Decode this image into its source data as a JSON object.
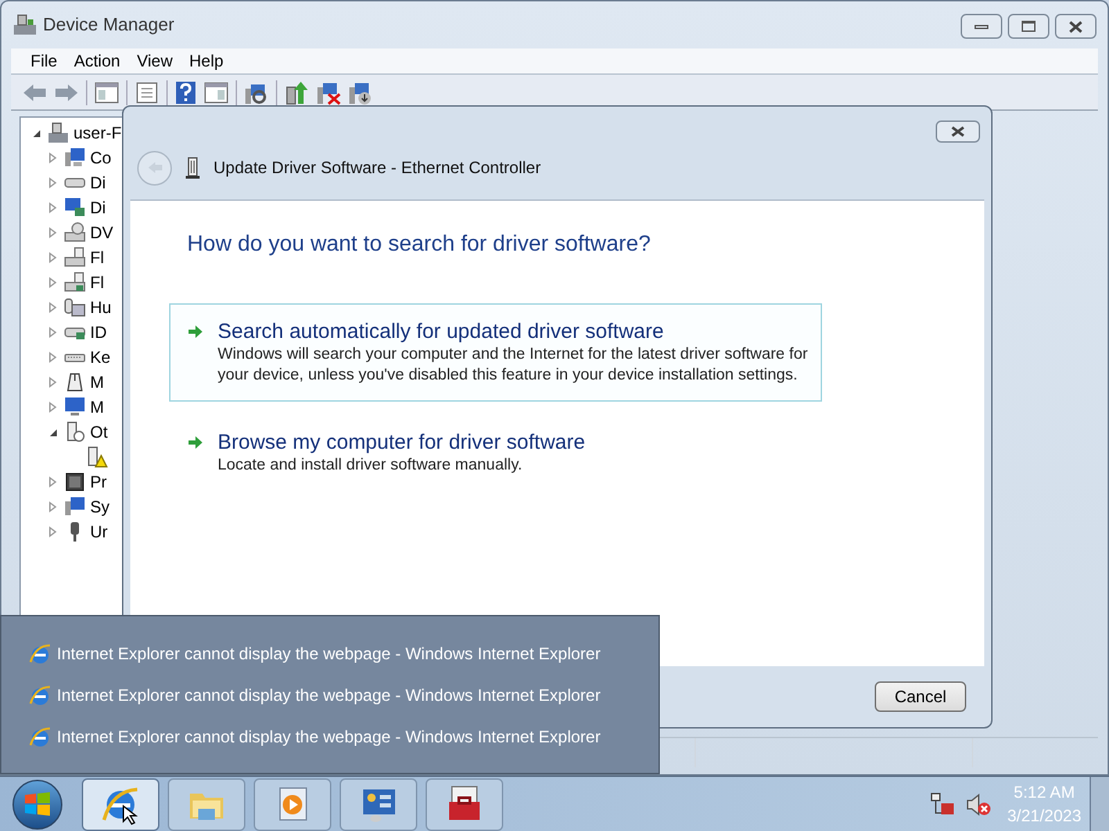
{
  "window": {
    "title": "Device Manager"
  },
  "menu": [
    "File",
    "Action",
    "View",
    "Help"
  ],
  "tree": {
    "label": "user-F",
    "expanded": true,
    "children": [
      {
        "label": "Co",
        "expanded": false
      },
      {
        "label": "Di",
        "expanded": false
      },
      {
        "label": "Di",
        "expanded": false
      },
      {
        "label": "DV",
        "expanded": false
      },
      {
        "label": "Fl",
        "expanded": false
      },
      {
        "label": "Fl",
        "expanded": false
      },
      {
        "label": "Hu",
        "expanded": false
      },
      {
        "label": "ID",
        "expanded": false
      },
      {
        "label": "Ke",
        "expanded": false
      },
      {
        "label": "M",
        "expanded": false
      },
      {
        "label": "M",
        "expanded": false
      },
      {
        "label": "Ot",
        "expanded": true,
        "children": [
          {
            "warning": true
          }
        ]
      },
      {
        "label": "Pr",
        "expanded": false
      },
      {
        "label": "Sy",
        "expanded": false
      },
      {
        "label": "Ur",
        "expanded": false
      }
    ]
  },
  "dialog": {
    "title": "Update Driver Software - Ethernet Controller",
    "back_disabled": true,
    "heading": "How do you want to search for driver software?",
    "options": [
      {
        "title": "Search automatically for updated driver software",
        "description": "Windows will search your computer and the Internet for the latest driver software for your device, unless you've disabled this feature in your device installation settings.",
        "selected": true
      },
      {
        "title": "Browse my computer for driver software",
        "description": "Locate and install driver software manually.",
        "selected": false
      }
    ],
    "cancel": "Cancel"
  },
  "taskbar_popup": [
    "Internet Explorer cannot display the webpage - Windows Internet Explorer",
    "Internet Explorer cannot display the webpage - Windows Internet Explorer",
    "Internet Explorer cannot display the webpage - Windows Internet Explorer"
  ],
  "taskbar": {
    "apps": [
      {
        "kind": "ie",
        "selected": true
      },
      {
        "kind": "folder",
        "selected": false
      },
      {
        "kind": "media",
        "selected": false
      },
      {
        "kind": "panel",
        "selected": false
      },
      {
        "kind": "toolbox",
        "selected": false
      }
    ],
    "clock": {
      "time": "5:12 AM",
      "date": "3/21/2023"
    }
  }
}
